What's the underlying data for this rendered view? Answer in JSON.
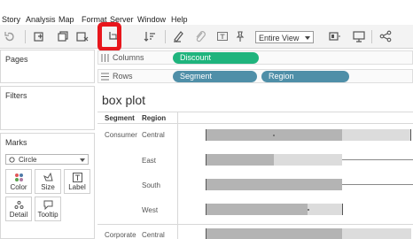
{
  "menu": [
    "Story",
    "Analysis",
    "Map",
    "Format",
    "Server",
    "Window",
    "Help"
  ],
  "toolbar": {
    "view_option": "Entire View"
  },
  "left_panels": {
    "pages_title": "Pages",
    "filters_title": "Filters",
    "marks_title": "Marks",
    "mark_type": "Circle",
    "mark_buttons": [
      "Color",
      "Size",
      "Label",
      "Detail",
      "Tooltip"
    ]
  },
  "shelves": {
    "columns_label": "Columns",
    "columns_pills": [
      "Discount"
    ],
    "rows_label": "Rows",
    "rows_pills": [
      "Segment",
      "Region"
    ]
  },
  "viz": {
    "title": "box plot",
    "headers": [
      "Segment",
      "Region"
    ],
    "rows": [
      {
        "segment": "Consumer",
        "region": "Central"
      },
      {
        "segment": "",
        "region": "East"
      },
      {
        "segment": "",
        "region": "South"
      },
      {
        "segment": "",
        "region": "West"
      },
      {
        "segment": "Corporate",
        "region": "Central"
      }
    ]
  },
  "colors": {
    "pill_green": "#1fb47d",
    "pill_blue": "#4f8fa8",
    "highlight": "#e8161c",
    "box_dark": "#b4b4b4",
    "box_light": "#dcdcdc"
  }
}
